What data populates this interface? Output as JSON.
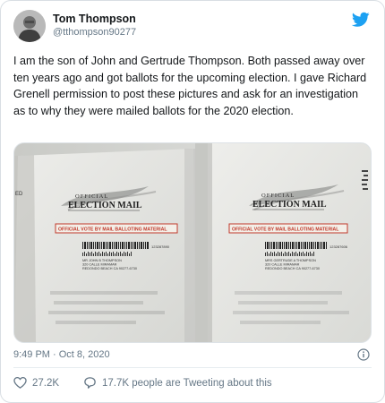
{
  "author": {
    "display_name": "Tom Thompson",
    "handle": "@tthompson90277"
  },
  "tweet": {
    "text": "I am the son of John and Gertrude Thompson.   Both passed away over ten years ago and got ballots for the upcoming election. I gave Richard Grenell permission to post these pictures and ask for an investigation as to why they were mailed ballots for the 2020 election.",
    "timestamp": "9:49 PM · Oct 8, 2020"
  },
  "media": {
    "left_envelope": {
      "title_line1": "OFFICIAL",
      "title_line2": "ELECTION MAIL",
      "notice": "OFFICIAL VOTE BY MAIL BALLOTING MATERIAL",
      "code": "123287890",
      "address": [
        "MR JOHN B THOMPSON",
        "320 CALLE MIRAMAR",
        "REDONDO BEACH CA 90277-6730"
      ],
      "edge_text": "ED"
    },
    "right_envelope": {
      "title_line1": "OFFICIAL",
      "title_line2": "ELECTION MAIL",
      "notice": "OFFICIAL VOTE BY MAIL BALLOTING MATERIAL",
      "code": "123287606",
      "address": [
        "MRS GERTRUDE A THOMPSON",
        "320 CALLE MIRAMAR",
        "REDONDO BEACH CA 90277-6730"
      ]
    }
  },
  "stats": {
    "likes": "27.2K",
    "tweeting": "17.7K people are Tweeting about this"
  },
  "colors": {
    "brand": "#1da1f2",
    "muted": "#657786",
    "notice_red": "#c0392b"
  },
  "icons": {
    "logo": "twitter-bird-icon",
    "info": "info-icon",
    "like": "heart-icon",
    "reply": "speech-bubble-icon"
  }
}
